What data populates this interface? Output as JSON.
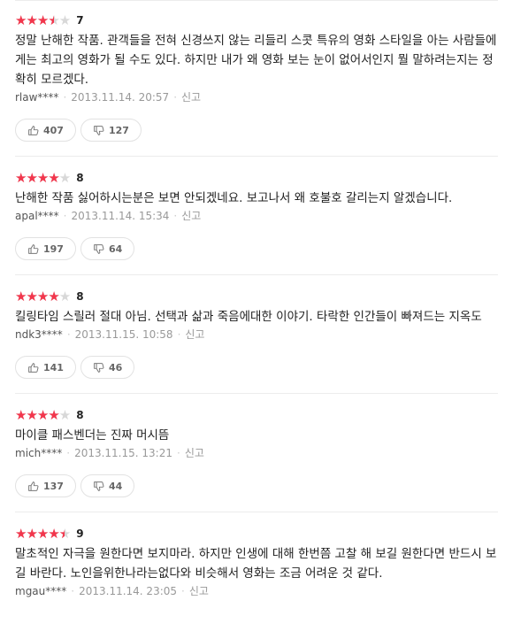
{
  "reviews": [
    {
      "stars": 3.5,
      "score": "7",
      "text": "정말 난해한 작품. 관객들을 전혀 신경쓰지 않는 리들리 스콧 특유의 영화 스타일을 아는 사람들에게는 최고의 영화가 될 수도 있다. 하지만 내가 왜 영화 보는 눈이 없어서인지 뭘 말하려는지는 정확히 모르겠다.",
      "user": "rlaw****",
      "date": "2013.11.14. 20:57",
      "report": "신고",
      "likes": "407",
      "dislikes": "127"
    },
    {
      "stars": 4,
      "score": "8",
      "text": "난해한 작품 싫어하시는분은 보면 안되겠네요. 보고나서 왜 호불호 갈리는지 알겠습니다.",
      "user": "apal****",
      "date": "2013.11.14. 15:34",
      "report": "신고",
      "likes": "197",
      "dislikes": "64"
    },
    {
      "stars": 4,
      "score": "8",
      "text": "킬링타임 스릴러 절대 아님. 선택과 삶과 죽음에대한 이야기. 타락한 인간들이 빠져드는 지옥도",
      "user": "ndk3****",
      "date": "2013.11.15. 10:58",
      "report": "신고",
      "likes": "141",
      "dislikes": "46"
    },
    {
      "stars": 4,
      "score": "8",
      "text": "마이클 패스벤더는 진짜 머시뜸",
      "user": "mich****",
      "date": "2013.11.15. 13:21",
      "report": "신고",
      "likes": "137",
      "dislikes": "44"
    },
    {
      "stars": 4.5,
      "score": "9",
      "text": "말초적인 자극을 원한다면 보지마라. 하지만 인생에 대해 한번쯤 고찰 해 보길 원한다면 반드시 보길 바란다. 노인을위한나라는없다와 비슷해서 영화는 조금 어려운 것 같다.",
      "user": "mgau****",
      "date": "2013.11.14. 23:05",
      "report": "신고"
    }
  ],
  "colors": {
    "star_on": "#f2364c",
    "star_off": "#d8d8d8"
  },
  "icons": {
    "like": "thumbs-up-icon",
    "dislike": "thumbs-down-icon"
  }
}
